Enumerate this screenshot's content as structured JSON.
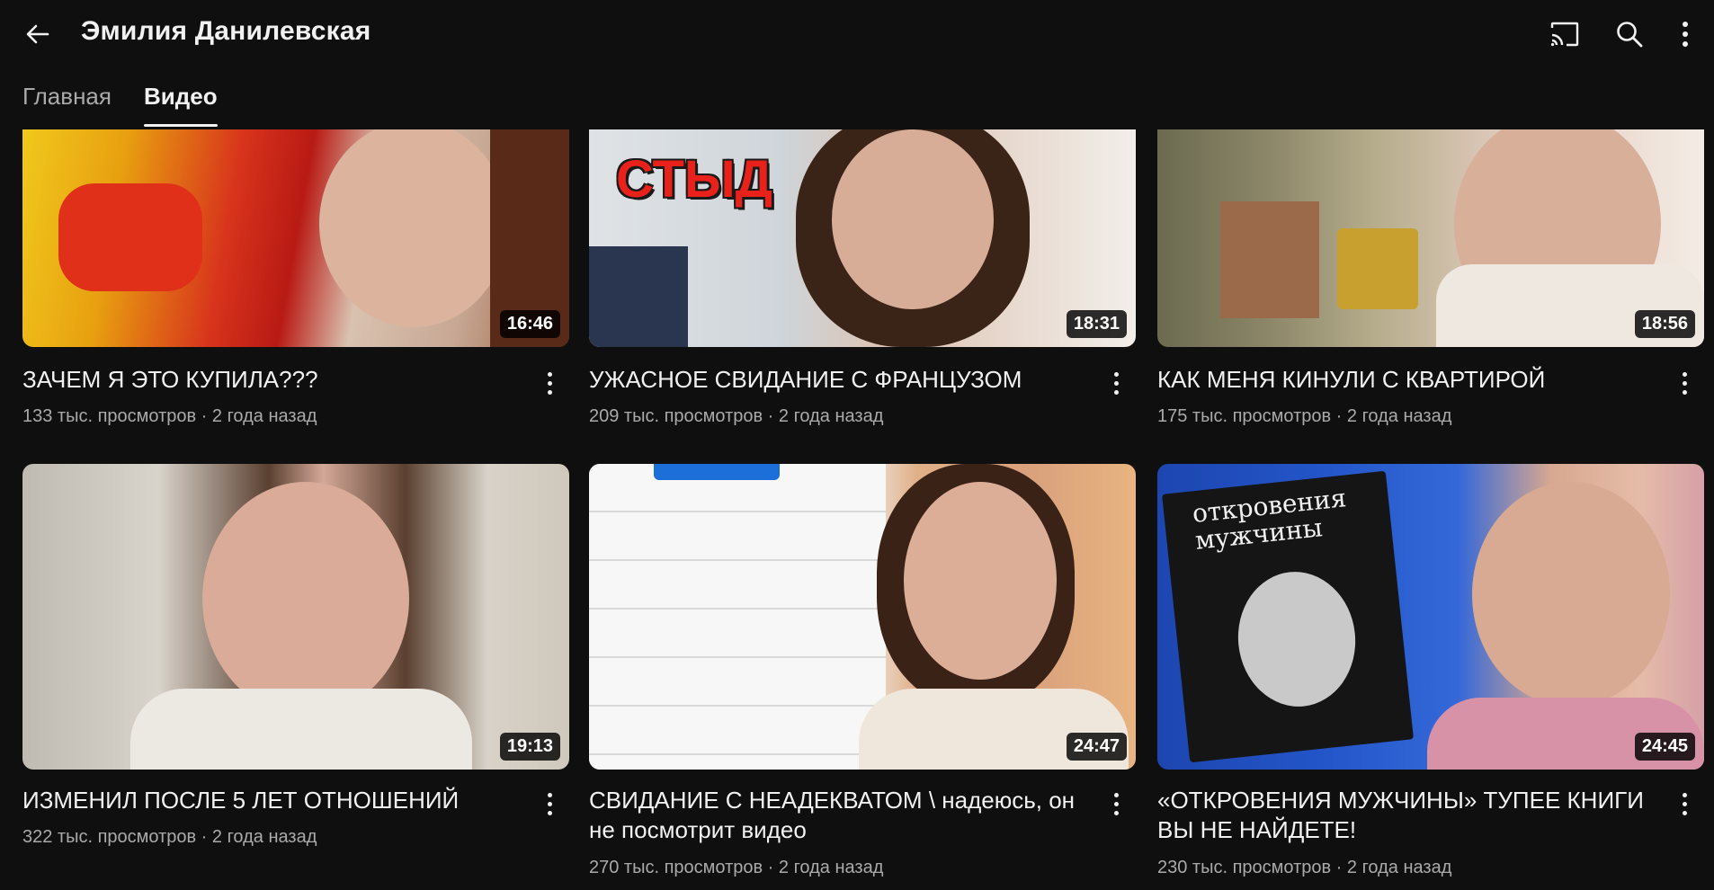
{
  "header": {
    "channel_name": "Эмилия Данилевская",
    "icons": [
      "back-arrow-icon",
      "cast-icon",
      "search-icon",
      "more-vert-icon"
    ]
  },
  "tabs": [
    {
      "label": "Главная",
      "active": false
    },
    {
      "label": "Видео",
      "active": true
    }
  ],
  "videos": [
    {
      "title": "ЗАЧЕМ Я ЭТО КУПИЛА???",
      "meta": "133 тыс. просмотров · 2 года назад",
      "duration": "16:46"
    },
    {
      "title": "УЖАСНОЕ СВИДАНИЕ С ФРАНЦУЗОМ",
      "meta": "209 тыс. просмотров · 2 года назад",
      "duration": "18:31",
      "overlay": "СТЫД"
    },
    {
      "title": "КАК МЕНЯ КИНУЛИ С КВАРТИРОЙ",
      "meta": "175 тыс. просмотров · 2 года назад",
      "duration": "18:56"
    },
    {
      "title": "ИЗМЕНИЛ ПОСЛЕ 5 ЛЕТ ОТНОШЕНИЙ",
      "meta": "322 тыс. просмотров · 2 года назад",
      "duration": "19:13"
    },
    {
      "title": "СВИДАНИЕ С НЕАДЕКВАТОМ \\ надеюсь, он не посмотрит видео",
      "meta": "270 тыс. просмотров · 2 года назад",
      "duration": "24:47"
    },
    {
      "title": "«ОТКРОВЕНИЯ МУЖЧИНЫ» ТУПЕЕ КНИГИ ВЫ НЕ НАЙДЕТЕ!",
      "meta": "230 тыс. просмотров · 2 года назад",
      "duration": "24:45",
      "overlay": "откровения мужчины"
    }
  ],
  "colors": {
    "background": "#0f0f0f",
    "text": "#f1f1f1",
    "secondary_text": "#aaaaaa"
  }
}
